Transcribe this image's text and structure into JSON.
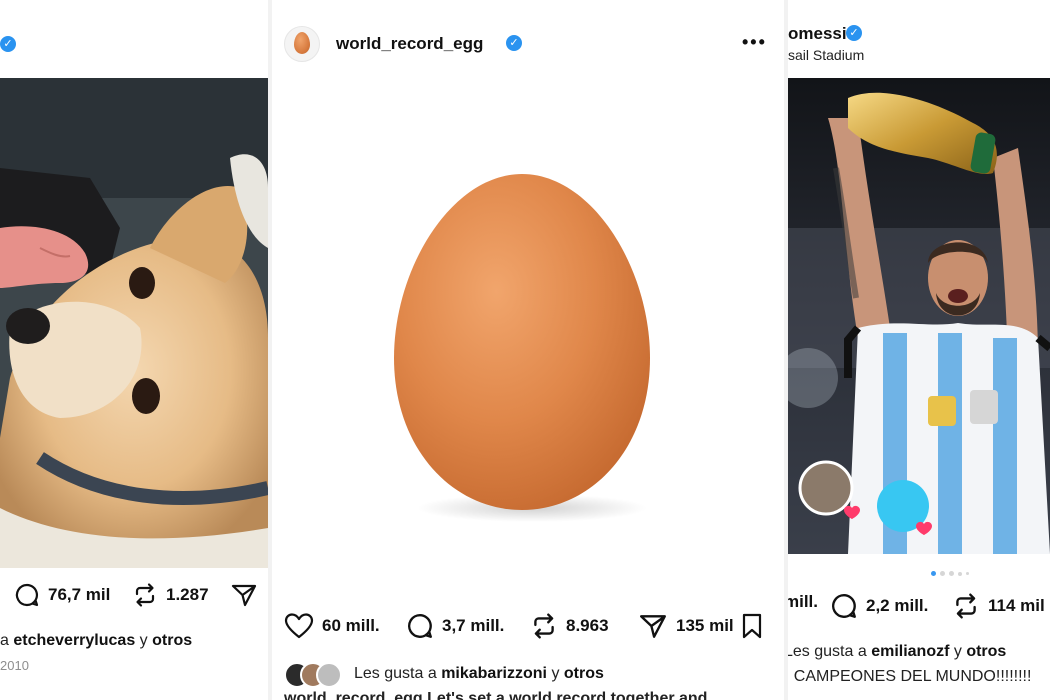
{
  "colors": {
    "verified": "#2a93f0",
    "dot_active": "#3897f0",
    "heart": "#ff3b6b"
  },
  "left_post": {
    "actions": {
      "comments": "76,7 mil",
      "reposts": "1.287"
    },
    "caption": {
      "prefix": "a",
      "user": "etcheverrylucas",
      "connector": "y",
      "others": "otros"
    },
    "date": "2010"
  },
  "middle_post": {
    "username": "world_record_egg",
    "actions": {
      "likes": "60 mill.",
      "comments": "3,7 mill.",
      "reposts": "8.963",
      "shares": "135 mil"
    },
    "liked_by": {
      "prefix": "Les gusta a",
      "user": "mikabarizzoni",
      "connector": "y",
      "others": "otros"
    },
    "caption_cut": "world_record_egg Let's set a world record together and"
  },
  "right_post": {
    "username": "omessi",
    "location": "sail Stadium",
    "actions": {
      "likes": "mill.",
      "comments": "2,2 mill.",
      "reposts": "114 mil"
    },
    "liked_by": {
      "prefix": "Les gusta a",
      "user": "emilianozf",
      "connector": "y",
      "others": "otros"
    },
    "caption": "¡ CAMPEONES DEL MUNDO!!!!!!!!",
    "carousel": {
      "total": 5,
      "active": 1
    }
  }
}
